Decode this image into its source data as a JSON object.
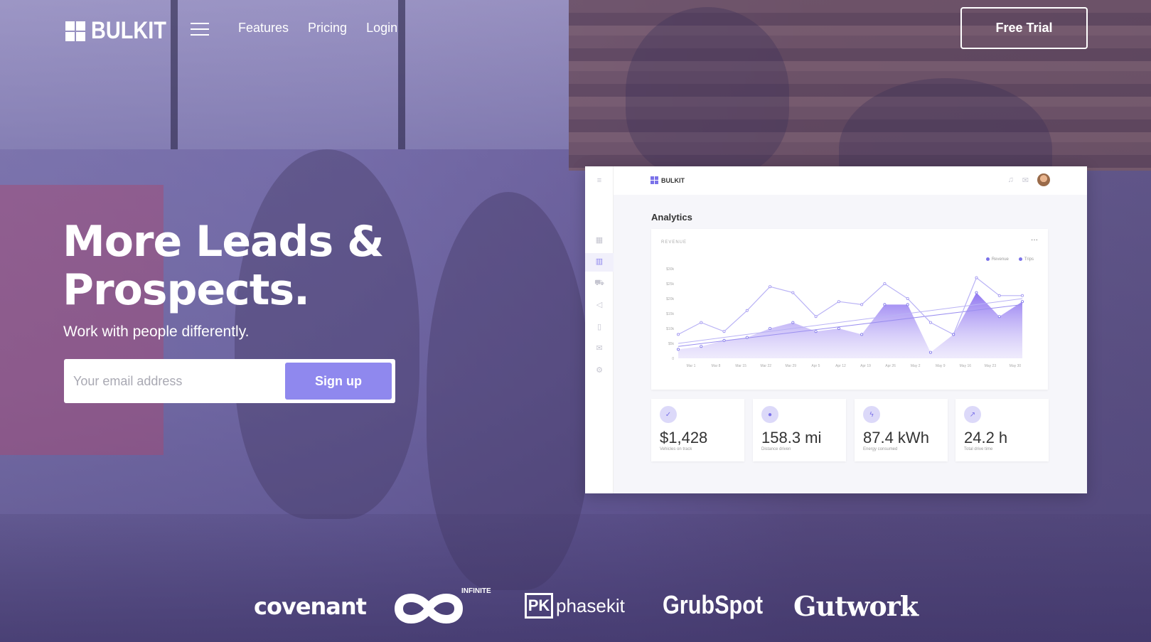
{
  "nav": {
    "logo_text": "BULKIT",
    "links": [
      "Features",
      "Pricing",
      "Login"
    ],
    "cta": "Free Trial"
  },
  "hero": {
    "title": "More Leads & Prospects.",
    "subtitle": "Work with people differently.",
    "email_placeholder": "Your email address",
    "signup_label": "Sign up"
  },
  "dashboard": {
    "logo_text": "BULKIT",
    "heading": "Analytics",
    "chart_title": "REVENUE",
    "legend": [
      "Revenue",
      "Trips"
    ],
    "stats": [
      {
        "icon": "check-icon",
        "value": "$1,428",
        "label": "Vehicles on track"
      },
      {
        "icon": "pin-icon",
        "value": "158.3 mi",
        "label": "Distance driven"
      },
      {
        "icon": "bolt-icon",
        "value": "87.4 kWh",
        "label": "Energy consumed"
      },
      {
        "icon": "trend-icon",
        "value": "24.2 h",
        "label": "Total drive time"
      }
    ]
  },
  "chart_data": {
    "type": "area",
    "title": "REVENUE",
    "categories": [
      "Mar 1",
      "Mar 8",
      "Mar 15",
      "Mar 22",
      "Mar 29",
      "Apr 5",
      "Apr 12",
      "Apr 19",
      "Apr 26",
      "May 2",
      "May 9",
      "May 16",
      "May 23",
      "May 30"
    ],
    "y_ticks": [
      "0",
      "$5k",
      "$10k",
      "$15k",
      "$20k",
      "$25k",
      "$30k"
    ],
    "ylim": [
      0,
      30000
    ],
    "series": [
      {
        "name": "Revenue",
        "color": "#8f7af0",
        "values": [
          3000,
          4000,
          6000,
          7000,
          10000,
          12000,
          9000,
          10000,
          8000,
          18000,
          18000,
          2000,
          8000,
          22000,
          14000,
          19000
        ]
      },
      {
        "name": "Trips",
        "color": "#b9b2f5",
        "values": [
          8000,
          12000,
          9000,
          16000,
          24000,
          22000,
          14000,
          19000,
          18000,
          25000,
          20000,
          12000,
          8000,
          27000,
          21000,
          21000
        ]
      }
    ],
    "legend_placement": "top-right"
  },
  "brands": [
    "covenant",
    "INFINITE",
    "phasekit",
    "GrubSpot",
    "Gutwork"
  ],
  "colors": {
    "accent": "#8f88ee",
    "overlay": "#7d76ad"
  }
}
